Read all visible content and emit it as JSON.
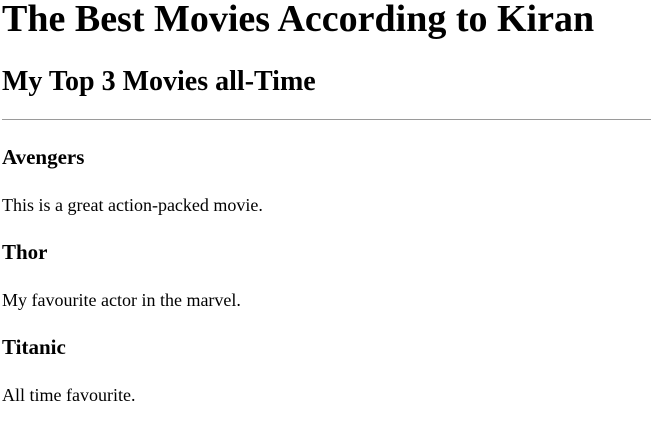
{
  "page": {
    "title": "The Best Movies According to Kiran",
    "subtitle": "My Top 3 Movies all-Time"
  },
  "movies": [
    {
      "name": "Avengers",
      "description": "This is a great action-packed movie."
    },
    {
      "name": "Thor",
      "description": "My favourite actor in the marvel."
    },
    {
      "name": "Titanic",
      "description": "All time favourite."
    }
  ]
}
